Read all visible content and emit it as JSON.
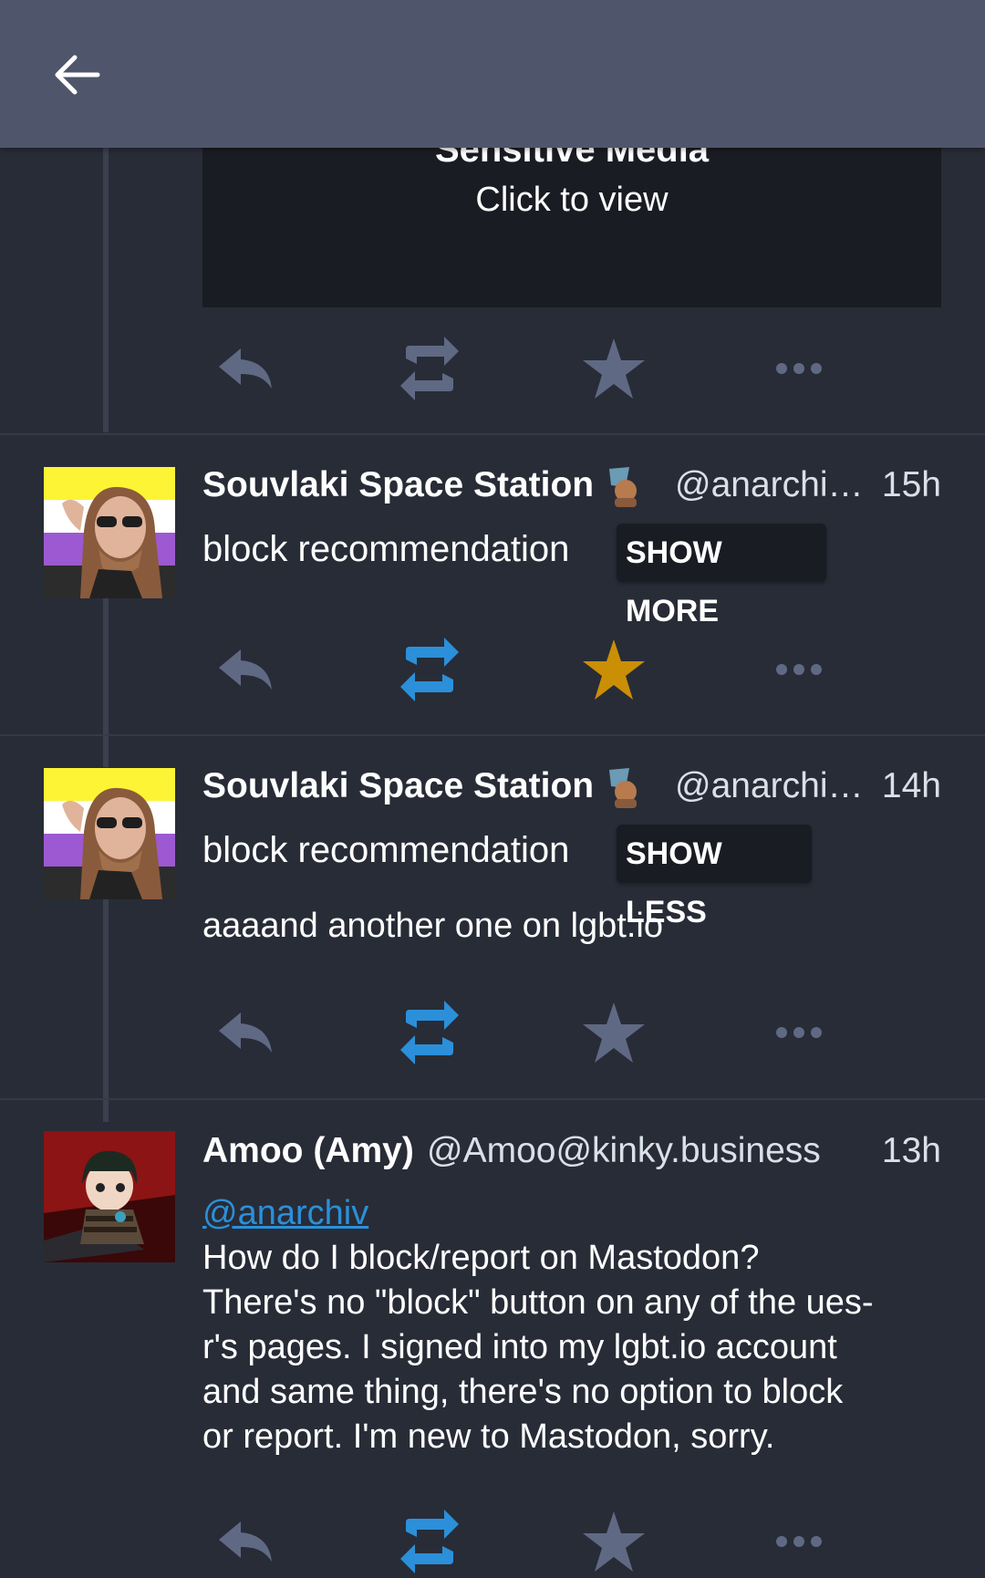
{
  "app_bar": {
    "back_icon": "arrow-left-icon"
  },
  "colors": {
    "background": "#282c37",
    "app_bar": "#4f566b",
    "icon_idle": "#606984",
    "boosted": "#2b90d9",
    "favourited": "#ca8f04",
    "link": "#2b90d9"
  },
  "sensitive_media": {
    "title": "Sensitive Media",
    "subtitle": "Click to view"
  },
  "statuses": [
    {
      "display_name": "Souvlaki Space Station",
      "acct": "@anarchi…",
      "time": "15h",
      "spoiler": "block recommendation",
      "toggle_label": "SHOW MORE",
      "content": "",
      "boosted": true,
      "favourited": true
    },
    {
      "display_name": "Souvlaki Space Station",
      "acct": "@anarchi…",
      "time": "14h",
      "spoiler": "block recommendation",
      "toggle_label": "SHOW LESS",
      "content": "aaaand another one on lgbt.io",
      "boosted": true,
      "favourited": false
    },
    {
      "display_name": "Amoo (Amy)",
      "acct": "@Amoo@kinky.business",
      "time": "13h",
      "mention": "@anarchiv",
      "content_lines": [
        "How do I block/report on Mastodon?",
        "There's no \"block\" button on any of the ues-",
        "r's pages. I signed into my lgbt.io account",
        "and same thing, there's no option to block",
        "or report. I'm new to Mastodon, sorry."
      ],
      "boosted": true,
      "favourited": false
    }
  ],
  "action_icons": [
    "reply-icon",
    "boost-icon",
    "favourite-icon",
    "more-icon"
  ]
}
